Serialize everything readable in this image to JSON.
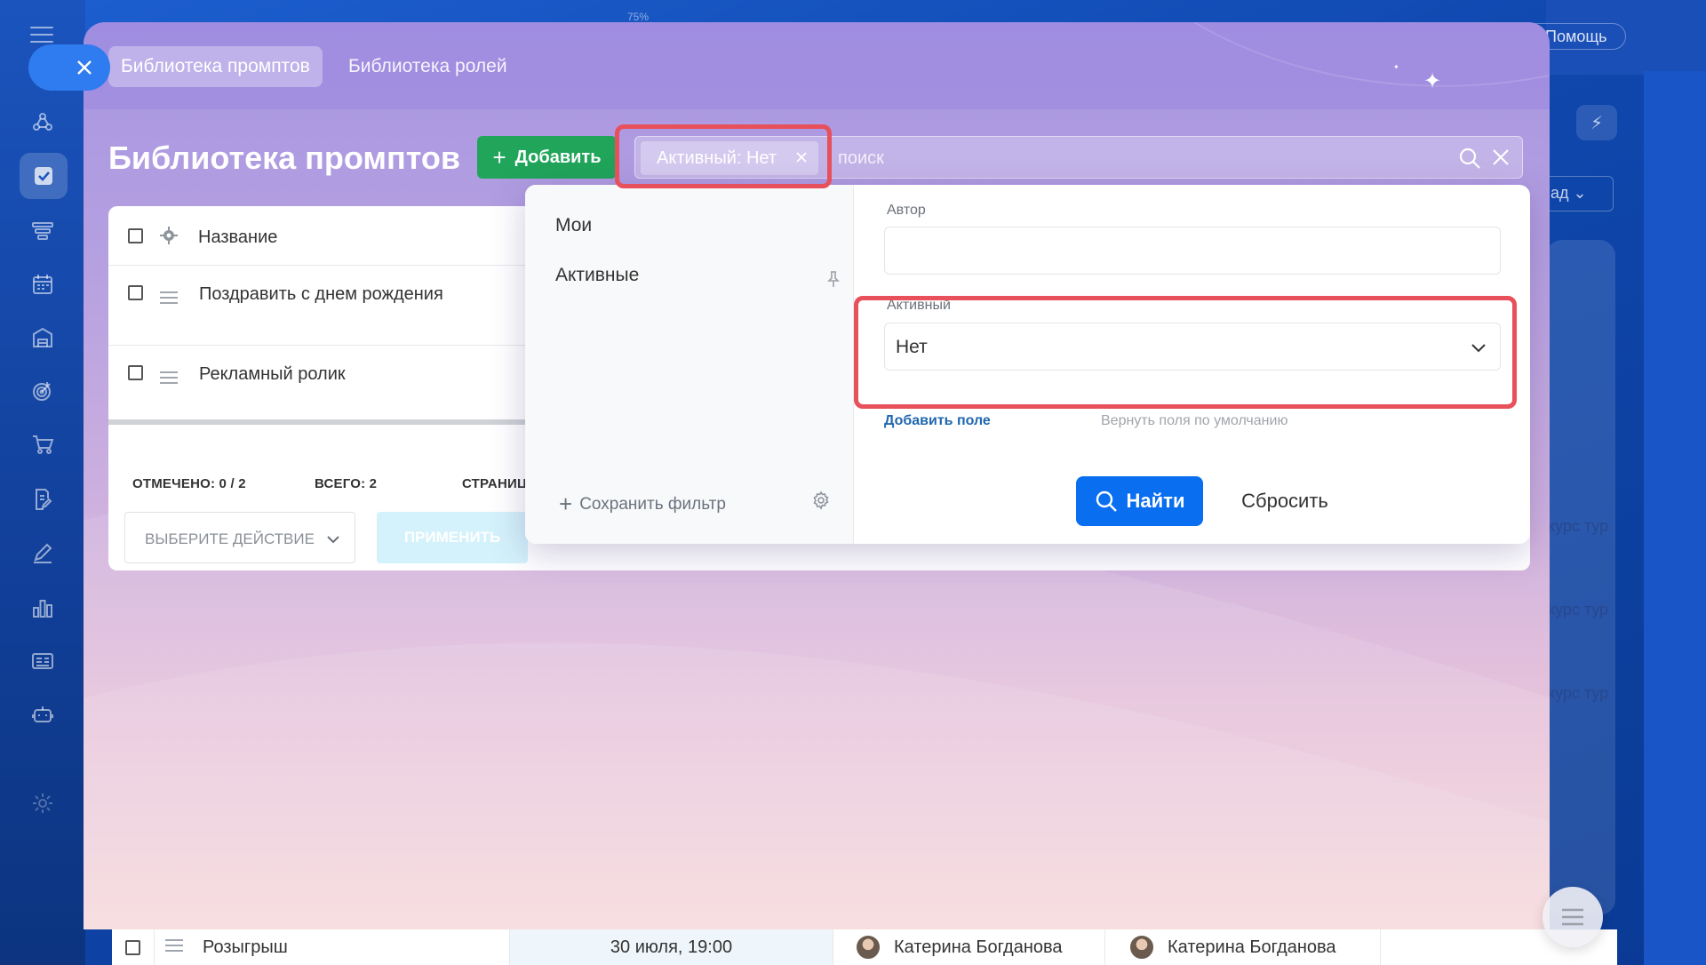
{
  "background": {
    "zoom": "75%",
    "help_label": "Помощь",
    "dropdown_snippet": "ад",
    "right_texts": [
      "курс тур",
      "курс тур",
      "курс тур"
    ],
    "bottom_row": {
      "name": "Розыгрыш",
      "date": "30 июля, 19:00",
      "person_1": "Катерина Богданова",
      "person_2": "Катерина Богданова"
    },
    "rail_icons": [
      "burger-icon",
      "network-icon",
      "task-check-icon",
      "funnel-icon",
      "calendar-icon",
      "building-icon",
      "target-icon",
      "cart-icon",
      "doc-edit-icon",
      "pen-icon",
      "bar-chart-icon",
      "id-card-icon",
      "robot-icon",
      "settings-icon"
    ]
  },
  "modal": {
    "tabs": [
      {
        "label": "Библиотека промптов",
        "active": true
      },
      {
        "label": "Библиотека ролей",
        "active": false
      }
    ],
    "title": "Библиотека промптов",
    "add_button": "Добавить",
    "search": {
      "chip": "Активный: Нет",
      "placeholder": "поиск"
    },
    "grid": {
      "header": "Название",
      "rows": [
        {
          "name": "Поздравить с днем рождения"
        },
        {
          "name": "Рекламный ролик"
        }
      ],
      "footer": {
        "marked_label": "ОТМЕЧЕНО:",
        "marked_value": "0 / 2",
        "total_label": "ВСЕГО:",
        "total_value": "2",
        "pages_label": "СТРАНИЦ"
      },
      "action_select": "ВЫБЕРИТЕ ДЕЙСТВИЕ",
      "apply_button": "ПРИМЕНИТЬ"
    },
    "filter_popup": {
      "presets": [
        "Мои",
        "Активные"
      ],
      "save_filter": "Сохранить фильтр",
      "fields": {
        "author_label": "Автор",
        "author_value": "",
        "active_label": "Активный",
        "active_value": "Нет"
      },
      "add_field": "Добавить поле",
      "restore_fields": "Вернуть поля по умолчанию",
      "find_button": "Найти",
      "reset_button": "Сбросить"
    }
  },
  "colors": {
    "highlight": "#e8505b",
    "add_button": "#20a55a",
    "find_button": "#0a6ef0",
    "link": "#2067b0"
  }
}
